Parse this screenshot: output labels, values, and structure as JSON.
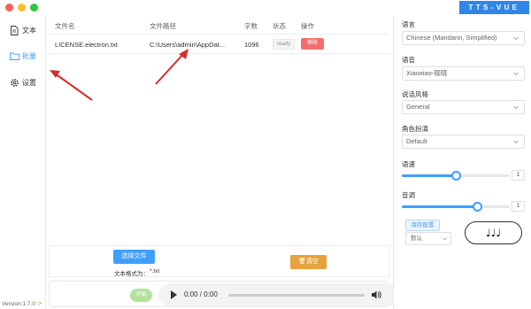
{
  "window": {
    "brand": "TTS-VUE",
    "colors": {
      "close": "#fe5f57",
      "minimize": "#febc2e",
      "maximize": "#28c840",
      "accent": "#409eff",
      "danger": "#f56c6c",
      "warning": "#e6a23c"
    }
  },
  "sidebar": {
    "items": [
      {
        "label": "文本",
        "icon": "document-icon"
      },
      {
        "label": "批量",
        "icon": "folder-icon",
        "active": true
      },
      {
        "label": "设置",
        "icon": "gear-icon"
      }
    ],
    "version": "Version:1.7.0"
  },
  "table": {
    "headers": {
      "filename": "文件名",
      "filepath": "文件路径",
      "chars": "字数",
      "status": "状态",
      "action": "操作"
    },
    "rows": [
      {
        "filename": "LICENSE.electron.txt",
        "filepath": "C:\\Users\\admin\\AppDat...",
        "chars": "1096",
        "status": "ready",
        "action": "移除"
      }
    ]
  },
  "batch": {
    "choose_label": "选择文件",
    "format_label": "文本格式为：",
    "format_value": "*.txt",
    "clear_label": "清空"
  },
  "player": {
    "play_label": "开始",
    "time": "0:00 / 0:00",
    "more": "⋮"
  },
  "settings": {
    "language_label": "语言",
    "language_value": "Chinese (Mandarin, Simplified)",
    "voice_label": "语音",
    "voice_value": "Xiaoxiao-晓晓",
    "style_label": "说话风格",
    "style_value": "General",
    "role_label": "角色扮演",
    "role_value": "Default",
    "speed_label": "语速",
    "speed_value": "1",
    "speed_fraction": 0.5,
    "pitch_label": "音调",
    "pitch_value": "1",
    "pitch_fraction": 0.7,
    "save_label": "保存配置",
    "preset_value": "默认",
    "notes": "♩♩♩"
  }
}
